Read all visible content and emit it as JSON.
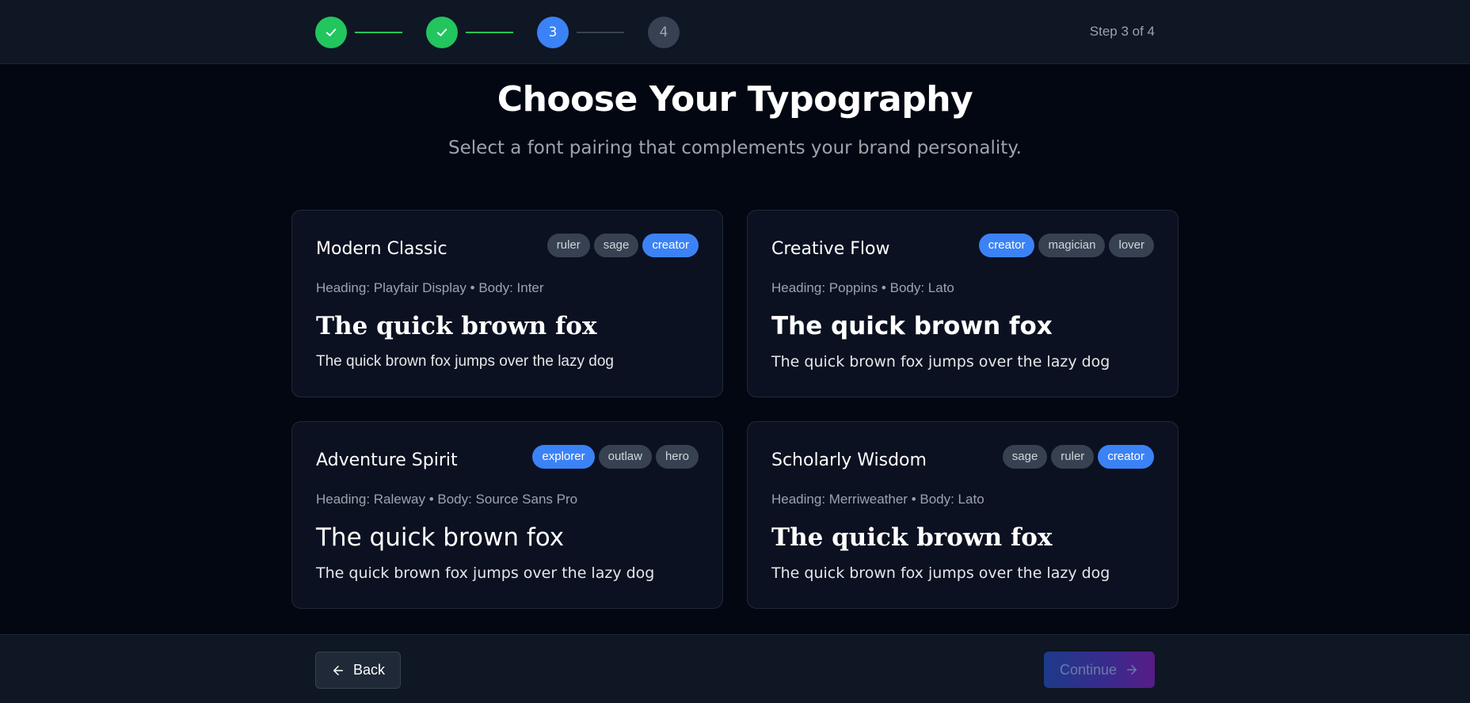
{
  "progress": {
    "steps": [
      {
        "label": "",
        "state": "done"
      },
      {
        "label": "",
        "state": "done"
      },
      {
        "label": "3",
        "state": "active"
      },
      {
        "label": "4",
        "state": "pending"
      }
    ],
    "counter_text": "Step 3 of 4"
  },
  "header": {
    "title": "Choose Your Typography",
    "subtitle": "Select a font pairing that complements your brand personality."
  },
  "font_options": [
    {
      "name": "Modern Classic",
      "tags": [
        "ruler",
        "sage",
        "creator"
      ],
      "highlighted_tag": "creator",
      "fonts_label": "Heading: Playfair Display • Body: Inter",
      "sample_heading": "The quick brown fox",
      "sample_body": "The quick brown fox jumps over the lazy dog"
    },
    {
      "name": "Creative Flow",
      "tags": [
        "creator",
        "magician",
        "lover"
      ],
      "highlighted_tag": "creator",
      "fonts_label": "Heading: Poppins • Body: Lato",
      "sample_heading": "The quick brown fox",
      "sample_body": "The quick brown fox jumps over the lazy dog"
    },
    {
      "name": "Adventure Spirit",
      "tags": [
        "explorer",
        "outlaw",
        "hero"
      ],
      "highlighted_tag": "explorer",
      "fonts_label": "Heading: Raleway • Body: Source Sans Pro",
      "sample_heading": "The quick brown fox",
      "sample_body": "The quick brown fox jumps over the lazy dog"
    },
    {
      "name": "Scholarly Wisdom",
      "tags": [
        "sage",
        "ruler",
        "creator"
      ],
      "highlighted_tag": "creator",
      "fonts_label": "Heading: Merriweather • Body: Lato",
      "sample_heading": "The quick brown fox",
      "sample_body": "The quick brown fox jumps over the lazy dog"
    }
  ],
  "footer": {
    "back_label": "Back",
    "continue_label": "Continue"
  },
  "colors": {
    "background": "#030712",
    "card": "#0b1120",
    "success": "#22c55e",
    "accent": "#3b82f6",
    "tag": "#374151"
  },
  "icons": {
    "step_done": "check-icon",
    "back": "arrow-left-icon",
    "continue": "arrow-right-icon"
  }
}
